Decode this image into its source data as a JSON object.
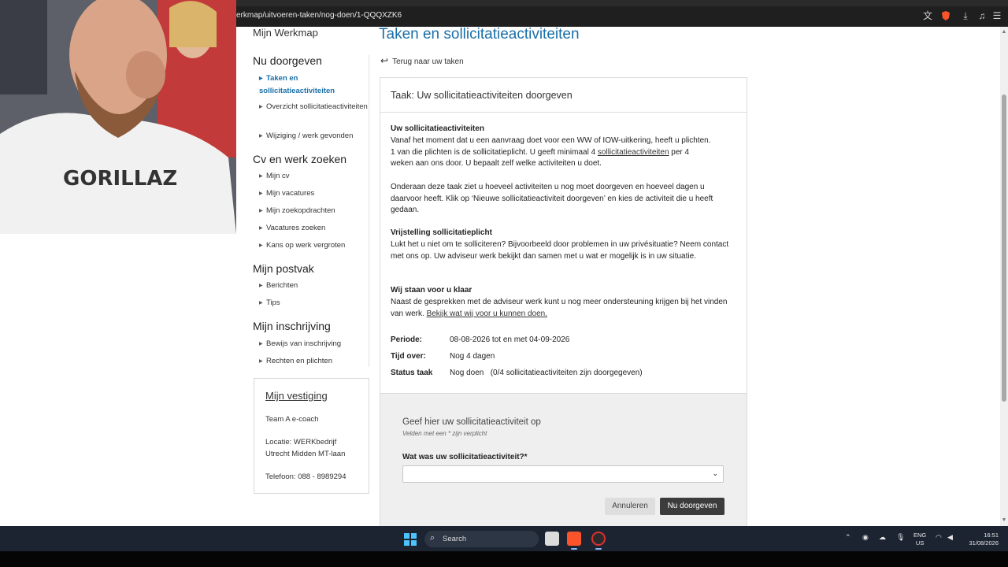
{
  "browser": {
    "url": "erkmap/uitvoeren-taken/nog-doen/1-QQQXZK6"
  },
  "sidebar": {
    "top_label": "Mijn Werkmap",
    "sections": [
      {
        "heading": "Nu doorgeven",
        "items": [
          {
            "label": "Taken en sollicitatieactiviteiten",
            "active": true
          },
          {
            "label": "Overzicht sollicitatieactiviteiten"
          },
          {
            "label": "Wijziging / werk gevonden"
          }
        ]
      },
      {
        "heading": "Cv en werk zoeken",
        "items": [
          {
            "label": "Mijn cv"
          },
          {
            "label": "Mijn vacatures"
          },
          {
            "label": "Mijn zoekopdrachten"
          },
          {
            "label": "Vacatures zoeken"
          },
          {
            "label": "Kans op werk vergroten"
          }
        ]
      },
      {
        "heading": "Mijn postvak",
        "items": [
          {
            "label": "Berichten"
          },
          {
            "label": "Tips"
          }
        ]
      },
      {
        "heading": "Mijn inschrijving",
        "items": [
          {
            "label": "Bewijs van inschrijving"
          },
          {
            "label": "Rechten en plichten"
          }
        ]
      }
    ]
  },
  "vestiging": {
    "title": "Mijn vestiging",
    "team": "Team A e-coach",
    "location_line1": "Locatie: WERKbedrijf",
    "location_line2": "Utrecht Midden MT-laan",
    "phone": "Telefoon: 088 - 8989294"
  },
  "main": {
    "title": "Taken en sollicitatieactiviteiten",
    "back_link": "Terug naar uw taken",
    "task_title": "Taak: Uw sollicitatieactiviteiten doorgeven",
    "sections": {
      "s1_title": "Uw sollicitatieactiviteiten",
      "s1_line1": "Vanaf het moment dat u een aanvraag doet voor een WW of IOW-uitkering, heeft u plichten.",
      "s1_line2a": "1 van die plichten is de sollicitatieplicht. U geeft minimaal 4 ",
      "s1_link": "sollicitatieactiviteiten",
      "s1_line2b": " per 4",
      "s1_line3": "weken aan ons door. U bepaalt zelf welke activiteiten u doet.",
      "s2_text": "Onderaan deze taak ziet u hoeveel activiteiten u nog moet doorgeven en hoeveel dagen u daarvoor heeft. Klik op ‘Nieuwe sollicitatieactiviteit doorgeven’ en kies de activiteit die u heeft gedaan.",
      "s3_title": "Vrijstelling sollicitatieplicht",
      "s3_text": "Lukt het u niet om te solliciteren? Bijvoorbeeld door problemen in uw privésituatie? Neem contact met ons op. Uw adviseur werk bekijkt dan samen met u wat er mogelijk is in uw situatie.",
      "s4_title": "Wij staan voor u klaar",
      "s4_text": "Naast de gesprekken met de adviseur werk kunt u nog meer ondersteuning krijgen bij het vinden van werk. ",
      "s4_link": "Bekijk wat wij voor u kunnen doen."
    },
    "info": {
      "periode_label": "Periode:",
      "periode_value": "08-08-2026 tot en met 04-09-2026",
      "tijd_label": "Tijd over:",
      "tijd_value": "Nog 4 dagen",
      "status_label": "Status taak",
      "status_value": "Nog doen   (0/4 sollicitatieactiviteiten zijn doorgegeven)"
    },
    "form": {
      "title": "Geef hier uw sollicitatieactiviteit op",
      "required_note": "Velden met een * zijn verplicht",
      "question": "Wat was uw sollicitatieactiviteit?*",
      "select_value": "",
      "cancel": "Annuleren",
      "submit": "Nu doorgeven"
    }
  },
  "taskbar": {
    "search": "Search",
    "lang_top": "ENG",
    "lang_bottom": "US",
    "time": "16:51",
    "date": "31/08/2026"
  },
  "colors": {
    "accent": "#1a6fa8",
    "taskbar": "#1c2431",
    "submit_button": "#3c3c3c"
  }
}
